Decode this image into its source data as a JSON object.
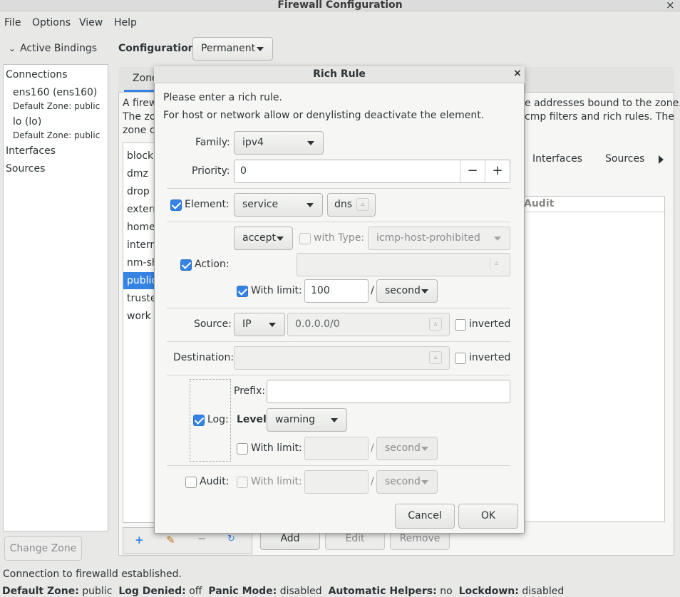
{
  "window": {
    "title": "Firewall Configuration",
    "close": "×"
  },
  "menu": [
    "File",
    "Options",
    "View",
    "Help"
  ],
  "left": {
    "header": "Active Bindings",
    "connections_label": "Connections",
    "connections": [
      {
        "name": "ens160 (ens160)",
        "zone": "Default Zone: public"
      },
      {
        "name": "lo (lo)",
        "zone": "Default Zone: public"
      }
    ],
    "interfaces_label": "Interfaces",
    "sources_label": "Sources",
    "change_zone": "Change Zone"
  },
  "config": {
    "label": "Configuration:",
    "value": "Permanent"
  },
  "main": {
    "tab_zone": "Zone",
    "desc_left": [
      "A firew",
      "The zo",
      "zone c"
    ],
    "desc_right": [
      "e addresses bound to the zone.",
      "cmp filters and rich rules. The"
    ],
    "zones": [
      "block",
      "dmz",
      "drop",
      "extern",
      "home",
      "intern",
      "nm-sh",
      "public",
      "truste",
      "work"
    ],
    "selected_zone": "public",
    "subtabs": [
      "Interfaces",
      "Sources"
    ],
    "audit_col": "Audit",
    "add": "Add",
    "edit": "Edit",
    "remove": "Remove"
  },
  "status": {
    "line1": "Connection to firewalld established.",
    "default_zone_label": "Default Zone:",
    "default_zone": "public",
    "log_denied_label": "Log Denied:",
    "log_denied": "off",
    "panic_label": "Panic Mode:",
    "panic": "disabled",
    "helpers_label": "Automatic Helpers:",
    "helpers": "no",
    "lockdown_label": "Lockdown:",
    "lockdown": "disabled"
  },
  "dialog": {
    "title": "Rich Rule",
    "close": "×",
    "intro1": "Please enter a rich rule.",
    "intro2": "For host or network allow or denylisting deactivate the element.",
    "family_label": "Family:",
    "family": "ipv4",
    "priority_label": "Priority:",
    "priority": "0",
    "minus": "−",
    "plus": "+",
    "element_label": "Element:",
    "element_checked": true,
    "element_type": "service",
    "element_value": "dns",
    "action_label": "Action:",
    "action_checked": true,
    "action": "accept",
    "with_type_label": "with Type:",
    "with_type_value": "icmp-host-prohibited",
    "action_limit_label": "With limit:",
    "action_limit": "100",
    "slash": "/",
    "action_limit_unit": "second",
    "source_label": "Source:",
    "source_type": "IP",
    "source_value": "0.0.0.0/0",
    "inverted": "inverted",
    "destination_label": "Destination:",
    "prefix_label": "Prefix:",
    "log_label": "Log:",
    "log_checked": true,
    "level_label": "Level:",
    "level": "warning",
    "log_limit_label": "With limit:",
    "log_limit_unit": "second",
    "audit_label": "Audit:",
    "audit_checked": false,
    "audit_limit_label": "With limit:",
    "audit_limit_unit": "second",
    "cancel": "Cancel",
    "ok": "OK"
  },
  "colors": {
    "accent": "#3584e4",
    "window_bg": "#e8e8e7",
    "dialog_bg": "#f6f6f5"
  }
}
